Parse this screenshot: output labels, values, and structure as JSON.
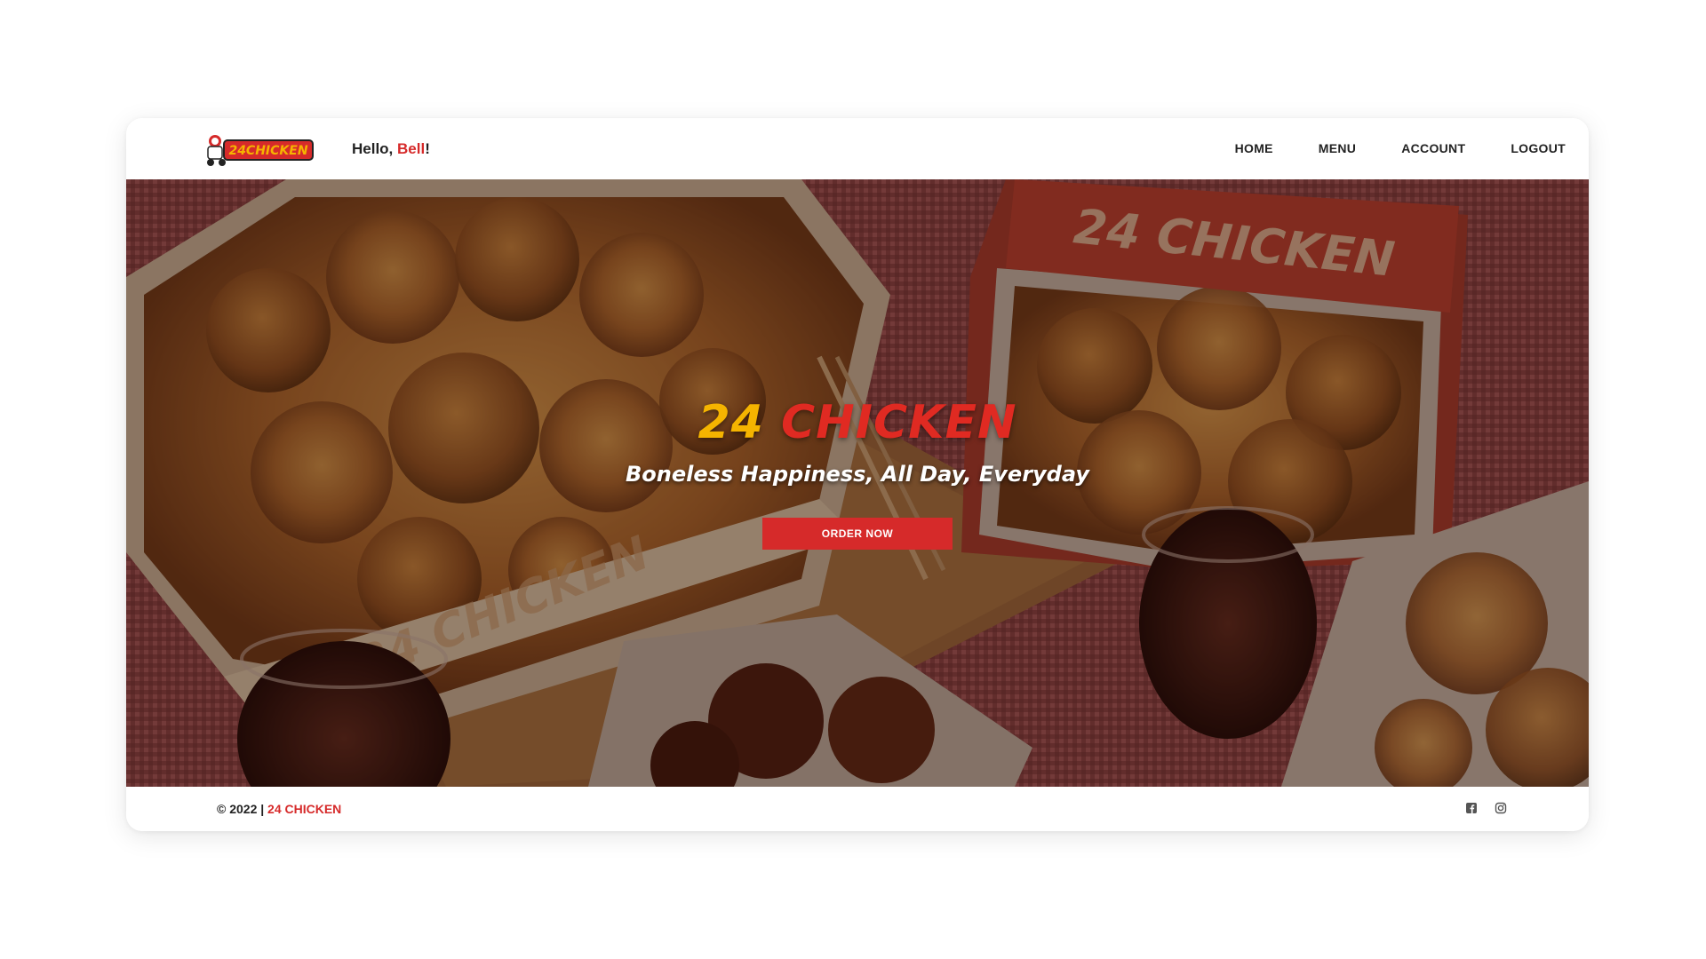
{
  "brand": {
    "logo_text": "24CHICKEN",
    "accent_color": "#d62a2a",
    "gold_color": "#f5b400"
  },
  "header": {
    "greeting_prefix": "Hello, ",
    "user_name": "Bell",
    "greeting_suffix": "!",
    "nav": [
      {
        "label": "HOME"
      },
      {
        "label": "MENU"
      },
      {
        "label": "ACCOUNT"
      },
      {
        "label": "LOGOUT"
      }
    ]
  },
  "hero": {
    "title_number": "24",
    "title_word": "CHICKEN",
    "tagline": "Boneless Happiness, All Day, Everyday",
    "cta_label": "ORDER NOW",
    "box_print": "24 CHICKEN"
  },
  "footer": {
    "copyright_prefix": "© 2022 | ",
    "copyright_brand": "24 CHICKEN",
    "socials": [
      {
        "icon": "facebook-icon"
      },
      {
        "icon": "instagram-icon"
      }
    ]
  }
}
